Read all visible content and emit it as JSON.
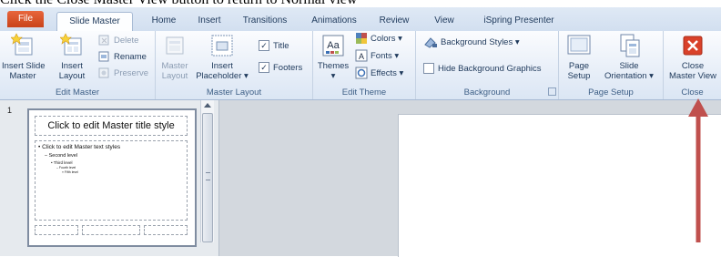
{
  "caption_fragment": "Click the Close Master View button to return to Normal view",
  "tabs": [
    "File",
    "Slide Master",
    "Home",
    "Insert",
    "Transitions",
    "Animations",
    "Review",
    "View",
    "iSpring Presenter"
  ],
  "groups": {
    "edit_master": {
      "label": "Edit Master",
      "insert_slide_master": [
        "Insert Slide",
        "Master"
      ],
      "insert_layout": [
        "Insert",
        "Layout"
      ],
      "delete": "Delete",
      "rename": "Rename",
      "preserve": "Preserve"
    },
    "master_layout": {
      "label": "Master Layout",
      "master_layout_btn": [
        "Master",
        "Layout"
      ],
      "insert_placeholder": [
        "Insert",
        "Placeholder"
      ],
      "title": "Title",
      "footers": "Footers"
    },
    "edit_theme": {
      "label": "Edit Theme",
      "themes": "Themes",
      "colors": "Colors",
      "fonts": "Fonts",
      "effects": "Effects"
    },
    "background": {
      "label": "Background",
      "background_styles": "Background Styles",
      "hide_background_graphics": "Hide Background Graphics"
    },
    "page_setup": {
      "label": "Page Setup",
      "page_setup_btn": [
        "Page",
        "Setup"
      ],
      "slide_orientation": [
        "Slide",
        "Orientation"
      ]
    },
    "close": {
      "label": "Close",
      "close_master_view": [
        "Close",
        "Master View"
      ]
    }
  },
  "thumbnail": {
    "slide_number": "1",
    "title_text": "Click to edit Master title style",
    "body_levels": [
      "Click to edit Master text styles",
      "Second level",
      "Third level",
      "Fourth level",
      "Fifth level"
    ]
  },
  "colors": {
    "file_tab": "#d2502a",
    "annotation_arrow": "#c0504d"
  }
}
